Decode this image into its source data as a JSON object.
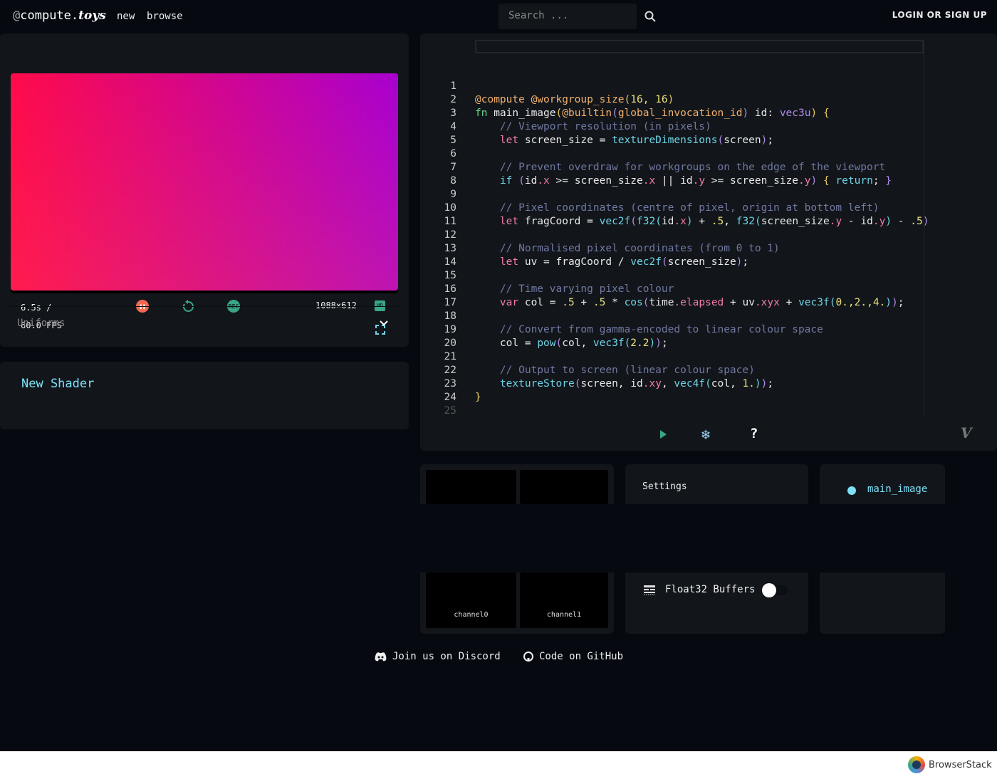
{
  "header": {
    "logo_at": "@",
    "logo_main": "compute.",
    "logo_toys": "toys",
    "nav": [
      "new",
      "browse"
    ],
    "search_placeholder": "Search ...",
    "login": "LOGIN OR SIGN UP"
  },
  "player": {
    "time": "6.5s /",
    "fps": "60.0 FPS",
    "resolution": "1088×612",
    "hd": "HD",
    "rec": "REC",
    "uniforms": "Uniforms",
    "gradient": [
      "#ff0a4a",
      "#a800d0"
    ]
  },
  "shader": {
    "title": "New Shader"
  },
  "editor": {
    "lines": [
      [],
      [
        [
          "a",
          "@compute "
        ],
        [
          "a",
          "@workgroup_size"
        ],
        [
          "p",
          "("
        ],
        [
          "n",
          "16, 16"
        ],
        [
          "p",
          ")"
        ]
      ],
      [
        [
          "fn",
          "fn "
        ],
        [
          "x",
          "main_image"
        ],
        [
          "p",
          "("
        ],
        [
          "a",
          "@builtin"
        ],
        [
          "t",
          "("
        ],
        [
          "a",
          "global_invocation_id"
        ],
        [
          "t",
          ")"
        ],
        [
          "x",
          " id: "
        ],
        [
          "t",
          "vec3u"
        ],
        [
          "p",
          ")"
        ],
        [
          "x",
          " "
        ],
        [
          "p",
          "{"
        ]
      ],
      [
        [
          "x",
          "    "
        ],
        [
          "c",
          "// Viewport resolution (in pixels)"
        ]
      ],
      [
        [
          "x",
          "    "
        ],
        [
          "k",
          "let "
        ],
        [
          "x",
          "screen_size = "
        ],
        [
          "f",
          "textureDimensions"
        ],
        [
          "t",
          "("
        ],
        [
          "x",
          "screen"
        ],
        [
          "t",
          ")"
        ],
        [
          "x",
          ";"
        ]
      ],
      [],
      [
        [
          "x",
          "    "
        ],
        [
          "c",
          "// Prevent overdraw for workgroups on the edge of the viewport"
        ]
      ],
      [
        [
          "x",
          "    "
        ],
        [
          "f",
          "if "
        ],
        [
          "t",
          "("
        ],
        [
          "x",
          "id"
        ],
        [
          "m",
          ".x"
        ],
        [
          "x",
          " >= screen_size"
        ],
        [
          "m",
          ".x"
        ],
        [
          "x",
          " || id"
        ],
        [
          "m",
          ".y"
        ],
        [
          "x",
          " >= screen_size"
        ],
        [
          "m",
          ".y"
        ],
        [
          "t",
          ")"
        ],
        [
          "x",
          " "
        ],
        [
          "p",
          "{"
        ],
        [
          "f",
          " return"
        ],
        [
          "x",
          "; "
        ],
        [
          "t",
          "}"
        ]
      ],
      [],
      [
        [
          "x",
          "    "
        ],
        [
          "c",
          "// Pixel coordinates (centre of pixel, origin at bottom left)"
        ]
      ],
      [
        [
          "x",
          "    "
        ],
        [
          "k",
          "let "
        ],
        [
          "x",
          "fragCoord = "
        ],
        [
          "f",
          "vec2f"
        ],
        [
          "t",
          "("
        ],
        [
          "f",
          "f32"
        ],
        [
          "f",
          "("
        ],
        [
          "x",
          "id"
        ],
        [
          "m",
          ".x"
        ],
        [
          "f",
          ")"
        ],
        [
          "x",
          " + "
        ],
        [
          "n",
          ".5"
        ],
        [
          "x",
          ", "
        ],
        [
          "f",
          "f32"
        ],
        [
          "f",
          "("
        ],
        [
          "x",
          "screen_size"
        ],
        [
          "m",
          ".y"
        ],
        [
          "x",
          " - id"
        ],
        [
          "m",
          ".y"
        ],
        [
          "f",
          ")"
        ],
        [
          "x",
          " - "
        ],
        [
          "n",
          ".5"
        ],
        [
          "t",
          ")"
        ]
      ],
      [],
      [
        [
          "x",
          "    "
        ],
        [
          "c",
          "// Normalised pixel coordinates (from 0 to 1)"
        ]
      ],
      [
        [
          "x",
          "    "
        ],
        [
          "k",
          "let "
        ],
        [
          "x",
          "uv = fragCoord / "
        ],
        [
          "f",
          "vec2f"
        ],
        [
          "t",
          "("
        ],
        [
          "x",
          "screen_size"
        ],
        [
          "t",
          ")"
        ],
        [
          "x",
          ";"
        ]
      ],
      [],
      [
        [
          "x",
          "    "
        ],
        [
          "c",
          "// Time varying pixel colour"
        ]
      ],
      [
        [
          "x",
          "    "
        ],
        [
          "k",
          "var "
        ],
        [
          "x",
          "col = "
        ],
        [
          "n",
          ".5"
        ],
        [
          "x",
          " + "
        ],
        [
          "n",
          ".5"
        ],
        [
          "x",
          " * "
        ],
        [
          "f",
          "cos"
        ],
        [
          "t",
          "("
        ],
        [
          "x",
          "time"
        ],
        [
          "m",
          ".elapsed"
        ],
        [
          "x",
          " + uv"
        ],
        [
          "m",
          ".xyx"
        ],
        [
          "x",
          " + "
        ],
        [
          "f",
          "vec3f"
        ],
        [
          "f",
          "("
        ],
        [
          "n",
          "0.,2.,4."
        ],
        [
          "f",
          ")"
        ],
        [
          "t",
          ")"
        ],
        [
          "x",
          ";"
        ]
      ],
      [],
      [
        [
          "x",
          "    "
        ],
        [
          "c",
          "// Convert from gamma-encoded to linear colour space"
        ]
      ],
      [
        [
          "x",
          "    "
        ],
        [
          "x",
          "col = "
        ],
        [
          "f",
          "pow"
        ],
        [
          "t",
          "("
        ],
        [
          "x",
          "col, "
        ],
        [
          "f",
          "vec3f"
        ],
        [
          "f",
          "("
        ],
        [
          "n",
          "2.2"
        ],
        [
          "f",
          ")"
        ],
        [
          "t",
          ")"
        ],
        [
          "x",
          ";"
        ]
      ],
      [],
      [
        [
          "x",
          "    "
        ],
        [
          "c",
          "// Output to screen (linear colour space)"
        ]
      ],
      [
        [
          "x",
          "    "
        ],
        [
          "f",
          "textureStore"
        ],
        [
          "t",
          "("
        ],
        [
          "x",
          "screen, id"
        ],
        [
          "m",
          ".xy"
        ],
        [
          "x",
          ", "
        ],
        [
          "f",
          "vec4f"
        ],
        [
          "f",
          "("
        ],
        [
          "x",
          "col, "
        ],
        [
          "n",
          "1."
        ],
        [
          "f",
          ")"
        ],
        [
          "t",
          ")"
        ],
        [
          "x",
          ";"
        ]
      ],
      [
        [
          "p",
          "}"
        ]
      ],
      []
    ],
    "help": "?",
    "vim": "V"
  },
  "settings": {
    "title": "Settings",
    "float32": "Float32 Buffers",
    "float32_enabled": false
  },
  "channels": [
    "channel0",
    "channel1"
  ],
  "entry": {
    "name": "main_image",
    "color": "#7ee0f8"
  },
  "footer": {
    "discord": "Join us on Discord",
    "github": "Code on GitHub"
  },
  "browserstack": {
    "label": "BrowserStack"
  }
}
